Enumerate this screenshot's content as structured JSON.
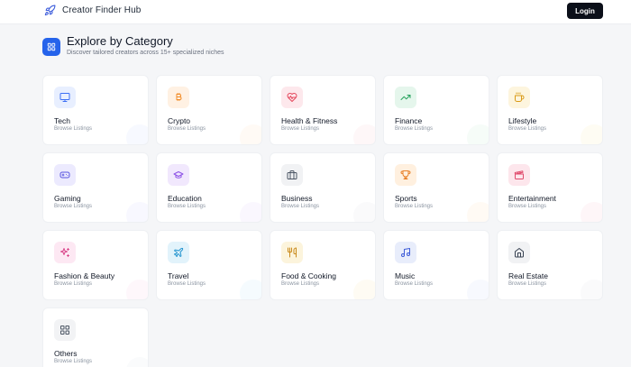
{
  "nav": {
    "brand": "Creator Finder Hub",
    "brand_icon": "rocket-icon",
    "login_label": "Login"
  },
  "section": {
    "icon": "grid-icon",
    "title": "Explore by Category",
    "subtitle": "Discover tailored creators across 15+ specialized niches"
  },
  "categories": [
    {
      "label": "Tech",
      "sub": "Browse Listings",
      "icon": "monitor-icon",
      "accent": "#3b6ef5"
    },
    {
      "label": "Crypto",
      "sub": "Browse Listings",
      "icon": "bitcoin-icon",
      "accent": "#f28c28"
    },
    {
      "label": "Health & Fitness",
      "sub": "Browse Listings",
      "icon": "heart-pulse-icon",
      "accent": "#e5485d"
    },
    {
      "label": "Finance",
      "sub": "Browse Listings",
      "icon": "trending-up-icon",
      "accent": "#2aa35f"
    },
    {
      "label": "Lifestyle",
      "sub": "Browse Listings",
      "icon": "coffee-icon",
      "accent": "#d99a16"
    },
    {
      "label": "Gaming",
      "sub": "Browse Listings",
      "icon": "gamepad-icon",
      "accent": "#5a55e0"
    },
    {
      "label": "Education",
      "sub": "Browse Listings",
      "icon": "graduation-cap-icon",
      "accent": "#8b4fe6"
    },
    {
      "label": "Business",
      "sub": "Browse Listings",
      "icon": "briefcase-icon",
      "accent": "#4b5563"
    },
    {
      "label": "Sports",
      "sub": "Browse Listings",
      "icon": "trophy-icon",
      "accent": "#e8812a"
    },
    {
      "label": "Entertainment",
      "sub": "Browse Listings",
      "icon": "clapperboard-icon",
      "accent": "#e04a6c"
    },
    {
      "label": "Fashion & Beauty",
      "sub": "Browse Listings",
      "icon": "sparkles-icon",
      "accent": "#d9468a"
    },
    {
      "label": "Travel",
      "sub": "Browse Listings",
      "icon": "plane-icon",
      "accent": "#2394cf"
    },
    {
      "label": "Food & Cooking",
      "sub": "Browse Listings",
      "icon": "utensils-icon",
      "accent": "#c98a1a"
    },
    {
      "label": "Music",
      "sub": "Browse Listings",
      "icon": "music-note-icon",
      "accent": "#3d5bd8"
    },
    {
      "label": "Real Estate",
      "sub": "Browse Listings",
      "icon": "home-icon",
      "accent": "#374151"
    },
    {
      "label": "Others",
      "sub": "Browse Listings",
      "icon": "grid-icon",
      "accent": "#4b5563"
    }
  ]
}
